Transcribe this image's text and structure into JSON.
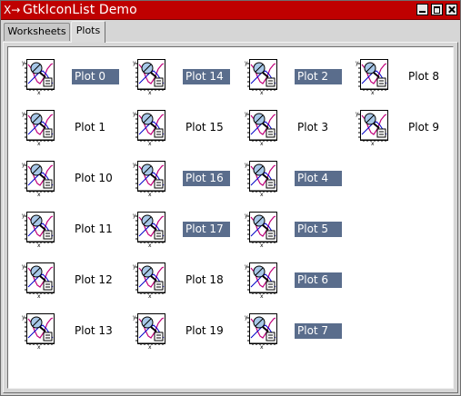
{
  "window": {
    "title": "GtkIconList Demo",
    "app_icon_glyph": "X→"
  },
  "tabs": [
    {
      "label": "Worksheets",
      "active": false
    },
    {
      "label": "Plots",
      "active": true
    }
  ],
  "selection_color": "#5a6d8c",
  "title_color": "#bf0000",
  "plot_icon": "plot-thumbnail-icon",
  "columns": [
    [
      {
        "label": "Plot 0",
        "selected": true
      },
      {
        "label": "Plot 1",
        "selected": false
      },
      {
        "label": "Plot 10",
        "selected": false
      },
      {
        "label": "Plot 11",
        "selected": false
      },
      {
        "label": "Plot 12",
        "selected": false
      },
      {
        "label": "Plot 13",
        "selected": false
      }
    ],
    [
      {
        "label": "Plot 14",
        "selected": true
      },
      {
        "label": "Plot 15",
        "selected": false
      },
      {
        "label": "Plot 16",
        "selected": true
      },
      {
        "label": "Plot 17",
        "selected": true
      },
      {
        "label": "Plot 18",
        "selected": false
      },
      {
        "label": "Plot 19",
        "selected": false
      }
    ],
    [
      {
        "label": "Plot 2",
        "selected": true
      },
      {
        "label": "Plot 3",
        "selected": false
      },
      {
        "label": "Plot 4",
        "selected": true
      },
      {
        "label": "Plot 5",
        "selected": true
      },
      {
        "label": "Plot 6",
        "selected": true
      },
      {
        "label": "Plot 7",
        "selected": true
      }
    ],
    [
      {
        "label": "Plot 8",
        "selected": false
      },
      {
        "label": "Plot 9",
        "selected": false
      }
    ]
  ]
}
